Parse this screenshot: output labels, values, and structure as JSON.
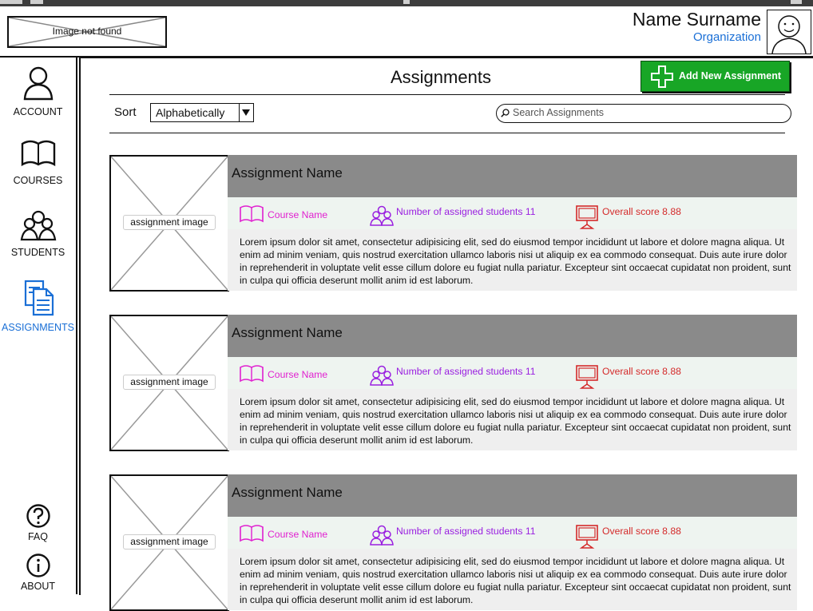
{
  "header": {
    "logo_placeholder": "Image not found",
    "user_name": "Name Surname",
    "organization": "Organization"
  },
  "sidebar": {
    "items": [
      {
        "label": "ACCOUNT",
        "icon": "user-icon"
      },
      {
        "label": "COURSES",
        "icon": "book-icon"
      },
      {
        "label": "STUDENTS",
        "icon": "group-icon"
      },
      {
        "label": "ASSIGNMENTS",
        "icon": "documents-icon",
        "active": true
      },
      {
        "label": "FAQ",
        "icon": "question-icon"
      },
      {
        "label": "ABOUT",
        "icon": "info-icon"
      }
    ]
  },
  "main": {
    "title": "Assignments",
    "add_button": "Add New Assignment",
    "sort_label": "Sort",
    "sort_value": "Alphabetically",
    "search_placeholder": "Search Assignments"
  },
  "assignments": [
    {
      "name": "Assignment Name",
      "image_label": "assignment image",
      "course": "Course Name",
      "students": "Number of assigned students 11",
      "score": "Overall score 8.88",
      "description": "Lorem ipsum dolor sit amet, consectetur adipisicing elit, sed do eiusmod tempor incididunt ut labore et dolore magna aliqua. Ut enim ad minim veniam, quis nostrud exercitation ullamco laboris nisi ut aliquip ex ea commodo consequat. Duis aute irure dolor in reprehenderit in voluptate velit esse cillum dolore eu fugiat nulla pariatur. Excepteur sint occaecat cupidatat non proident, sunt in culpa qui officia deserunt mollit anim id est laborum."
    },
    {
      "name": "Assignment Name",
      "image_label": "assignment image",
      "course": "Course Name",
      "students": "Number of assigned students 11",
      "score": "Overall score 8.88",
      "description": "Lorem ipsum dolor sit amet, consectetur adipisicing elit, sed do eiusmod tempor incididunt ut labore et dolore magna aliqua. Ut enim ad minim veniam, quis nostrud exercitation ullamco laboris nisi ut aliquip ex ea commodo consequat. Duis aute irure dolor in reprehenderit in voluptate velit esse cillum dolore eu fugiat nulla pariatur. Excepteur sint occaecat cupidatat non proident, sunt in culpa qui officia deserunt mollit anim id est laborum."
    },
    {
      "name": "Assignment Name",
      "image_label": "assignment image",
      "course": "Course Name",
      "students": "Number of assigned students 11",
      "score": "Overall score 8.88",
      "description": "Lorem ipsum dolor sit amet, consectetur adipisicing elit, sed do eiusmod tempor incididunt ut labore et dolore magna aliqua. Ut enim ad minim veniam, quis nostrud exercitation ullamco laboris nisi ut aliquip ex ea commodo consequat. Duis aute irure dolor in reprehenderit in voluptate velit esse cillum dolore eu fugiat nulla pariatur. Excepteur sint occaecat cupidatat non proident, sunt in culpa qui officia deserunt mollit anim id est laborum."
    }
  ],
  "colors": {
    "accent_blue": "#1a6fd6",
    "add_button_green": "#18a626",
    "course_magenta": "#e020d0",
    "students_purple": "#9a20e0",
    "score_red": "#d42a2a"
  }
}
